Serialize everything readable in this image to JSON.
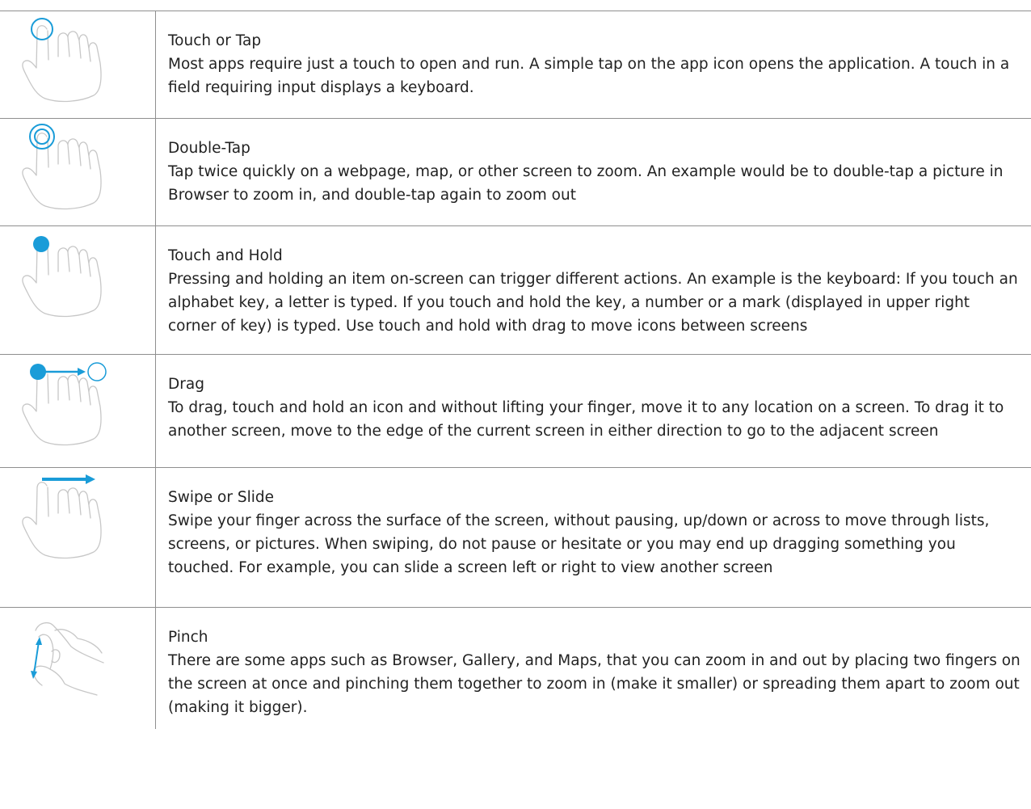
{
  "colors": {
    "accent": "#1a9cd8",
    "hand": "#c7c7c7",
    "rule": "#8f8f8f"
  },
  "gestures": [
    {
      "icon": "touch-tap-icon",
      "title": "Touch or Tap",
      "description": "Most apps require just a touch to open and run. A simple tap on the app icon opens the application. A touch in a field requiring input displays a keyboard."
    },
    {
      "icon": "double-tap-icon",
      "title": "Double-Tap",
      "description": "Tap twice quickly on a webpage, map, or other screen to zoom. An example would be to double-tap a picture in Browser to zoom in, and double-tap again to zoom out"
    },
    {
      "icon": "touch-hold-icon",
      "title": "Touch and Hold",
      "description": "Pressing and holding an item on-screen can trigger different actions. An example is the keyboard: If you touch an alphabet key, a letter is typed. If you touch and hold the key, a number or a mark (displayed in upper right corner of key) is typed. Use touch and hold with drag to move icons between screens"
    },
    {
      "icon": "drag-icon",
      "title": "Drag",
      "description": "To drag, touch and hold an icon and without lifting your finger, move it to any location on a screen. To drag it to another screen, move to the edge of the current screen in either direction to go to the adjacent screen"
    },
    {
      "icon": "swipe-icon",
      "title": "Swipe or Slide",
      "description": "Swipe your finger across the surface of the screen, without pausing, up/down or across to move through lists, screens, or pictures. When swiping, do not pause or hesitate or you may end up dragging something you touched. For example, you can slide a screen left or right to view another screen"
    },
    {
      "icon": "pinch-icon",
      "title": "Pinch",
      "description": "There are some apps such as Browser, Gallery, and  Maps, that you can zoom in and out by placing two fingers on the screen at once and pinching them together to zoom in (make it smaller) or spreading them apart to zoom out (making it bigger)."
    }
  ]
}
